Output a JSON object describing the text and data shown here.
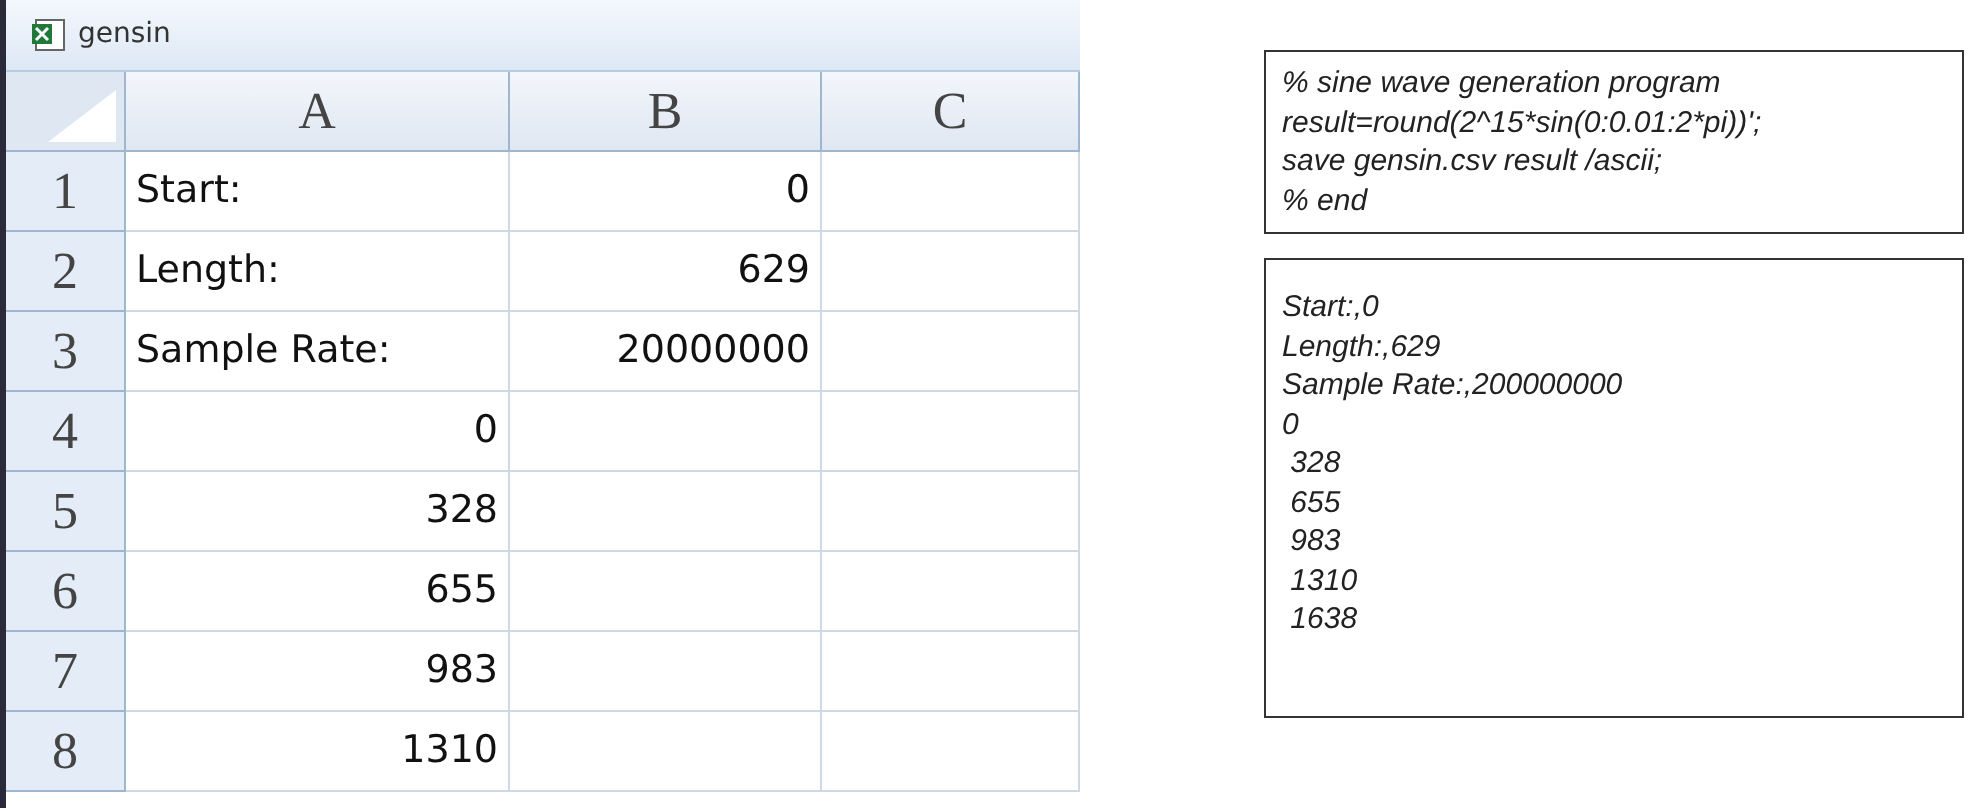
{
  "workbook": {
    "title": "gensin",
    "columns": [
      "A",
      "B",
      "C"
    ],
    "rows": [
      {
        "number": "1",
        "cells": [
          "Start:",
          "0",
          null
        ]
      },
      {
        "number": "2",
        "cells": [
          "Length:",
          "629",
          null
        ]
      },
      {
        "number": "3",
        "cells": [
          "Sample Rate:",
          "20000000",
          null
        ]
      },
      {
        "number": "4",
        "cells": [
          "0",
          null,
          null
        ]
      },
      {
        "number": "5",
        "cells": [
          "328",
          null,
          null
        ]
      },
      {
        "number": "6",
        "cells": [
          "655",
          null,
          null
        ]
      },
      {
        "number": "7",
        "cells": [
          "983",
          null,
          null
        ]
      },
      {
        "number": "8",
        "cells": [
          "1310",
          null,
          null
        ]
      }
    ]
  },
  "program": {
    "lines": [
      "% sine wave generation program",
      "result=round(2^15*sin(0:0.01:2*pi))';",
      "save gensin.csv result /ascii;",
      "% end"
    ]
  },
  "output": {
    "lines": [
      "Start:,0",
      "Length:,629",
      "Sample Rate:,200000000",
      "0",
      " 328",
      " 655",
      " 983",
      " 1310",
      " 1638"
    ]
  }
}
